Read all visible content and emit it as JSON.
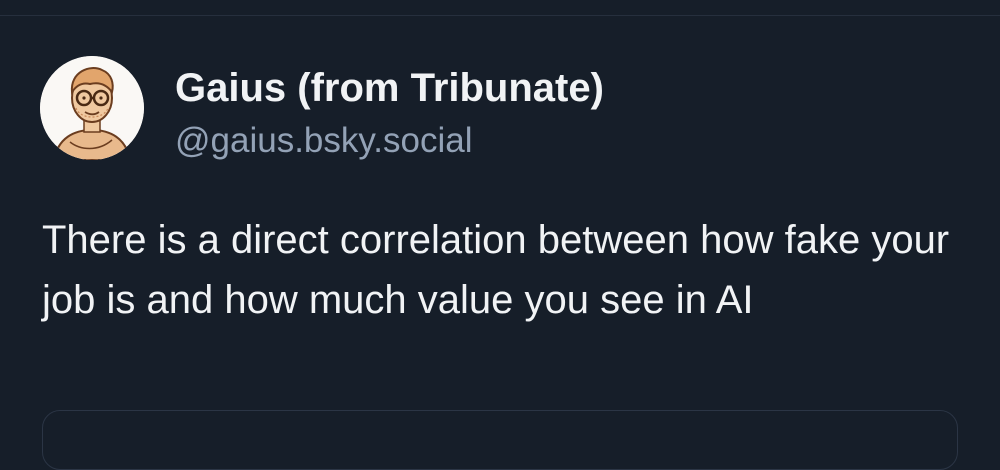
{
  "post": {
    "author": {
      "display_name": "Gaius (from Tribunate)",
      "handle": "@gaius.bsky.social",
      "avatar_icon": "illustrated-man-with-glasses-avatar"
    },
    "text": "There is a direct correlation between how fake your job is and how much value you see in AI"
  },
  "colors": {
    "background": "#161e29",
    "primary_text": "#f1f3f5",
    "secondary_text": "#93a2b6",
    "border": "#2b3545"
  }
}
